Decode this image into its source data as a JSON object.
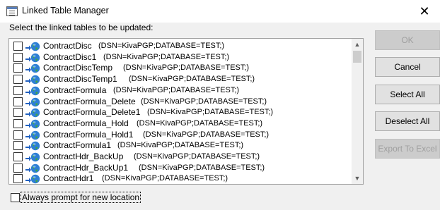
{
  "window": {
    "title": "Linked Table Manager",
    "close_glyph": "✕"
  },
  "instruction": "Select the linked tables to be updated:",
  "tables": [
    {
      "name": "ContractDisc",
      "connection": "(DSN=KivaPGP;DATABASE=TEST;)",
      "checked": false
    },
    {
      "name": "ContractDisc1",
      "connection": "(DSN=KivaPGP;DATABASE=TEST;)",
      "checked": false
    },
    {
      "name": "ContractDiscTemp",
      "connection": "(DSN=KivaPGP;DATABASE=TEST;)",
      "checked": false
    },
    {
      "name": "ContractDiscTemp1",
      "connection": "(DSN=KivaPGP;DATABASE=TEST;)",
      "checked": false
    },
    {
      "name": "ContractFormula",
      "connection": "(DSN=KivaPGP;DATABASE=TEST;)",
      "checked": false
    },
    {
      "name": "ContractFormula_Delete",
      "connection": "(DSN=KivaPGP;DATABASE=TEST;)",
      "checked": false
    },
    {
      "name": "ContractFormula_Delete1",
      "connection": "(DSN=KivaPGP;DATABASE=TEST;)",
      "checked": false
    },
    {
      "name": "ContractFormula_Hold",
      "connection": "(DSN=KivaPGP;DATABASE=TEST;)",
      "checked": false
    },
    {
      "name": "ContractFormula_Hold1",
      "connection": "(DSN=KivaPGP;DATABASE=TEST;)",
      "checked": false
    },
    {
      "name": "ContractFormula1",
      "connection": "(DSN=KivaPGP;DATABASE=TEST;)",
      "checked": false
    },
    {
      "name": "ContractHdr_BackUp",
      "connection": "(DSN=KivaPGP;DATABASE=TEST;)",
      "checked": false
    },
    {
      "name": "ContractHdr_BackUp1",
      "connection": "(DSN=KivaPGP;DATABASE=TEST;)",
      "checked": false
    },
    {
      "name": "ContractHdr1",
      "connection": "(DSN=KivaPGP;DATABASE=TEST;)",
      "checked": false
    }
  ],
  "buttons": {
    "ok": {
      "label": "OK",
      "enabled": false
    },
    "cancel": {
      "label": "Cancel",
      "enabled": true
    },
    "select_all": {
      "label": "Select All",
      "enabled": true
    },
    "deselect_all": {
      "label": "Deselect All",
      "enabled": true
    },
    "export_to_excel": {
      "label": "Export To Excel",
      "enabled": false
    }
  },
  "always_prompt": {
    "label": "Always prompt for new location",
    "checked": false
  },
  "icons": {
    "row_icon": "linked-table-globe-icon",
    "scroll_up": "chevron-up-icon",
    "scroll_down": "chevron-down-icon"
  },
  "colors": {
    "globe": "#2e7fd4",
    "arrow": "#1f5fbf",
    "disabled_text": "#a0a0a0"
  }
}
